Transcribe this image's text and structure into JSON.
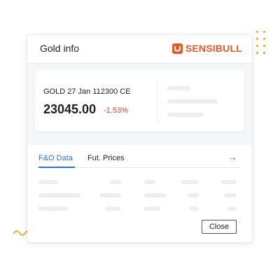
{
  "dialog": {
    "title": "Gold info",
    "brand": "SENSIBULL",
    "brand_icon": "sensibull-logo-icon",
    "close_label": "Close"
  },
  "quote": {
    "instrument": "GOLD 27 Jan 112300 CE",
    "price": "23045.00",
    "change": "-1.53%"
  },
  "tabs": [
    {
      "label": "F&O Data",
      "active": true
    },
    {
      "label": "Fut. Prices",
      "active": false
    }
  ],
  "icons": {
    "next_tab": "arrow-right-icon"
  },
  "colors": {
    "brand": "#e55a2b",
    "accent": "#2f6fd6",
    "negative": "#d63b2f",
    "decoration": "#f2a93b"
  }
}
